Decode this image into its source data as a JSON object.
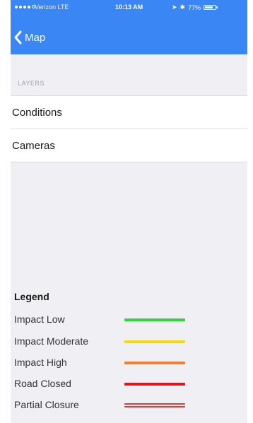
{
  "status_bar": {
    "carrier": "Verizon  LTE",
    "time": "10:13 AM",
    "battery": "77%",
    "battery_level": 0.77,
    "signal_bars_filled": 4,
    "signal_bars_total": 5
  },
  "nav": {
    "back_label": "Map"
  },
  "layers": {
    "header": "LAYERS",
    "items": [
      {
        "label": "Conditions"
      },
      {
        "label": "Cameras"
      }
    ]
  },
  "legend": {
    "title": "Legend",
    "items": [
      {
        "label": "Impact Low",
        "color": "#2fd63a",
        "style": "solid"
      },
      {
        "label": "Impact Moderate",
        "color": "#f5d90f",
        "style": "solid"
      },
      {
        "label": "Impact High",
        "color": "#f08030",
        "style": "solid"
      },
      {
        "label": "Road Closed",
        "color": "#e3121b",
        "style": "solid"
      },
      {
        "label": "Partial Closure",
        "color": "#e03c3c",
        "style": "double"
      }
    ]
  },
  "colors": {
    "nav_bar": "#3b86f5",
    "background": "#efeff4"
  }
}
